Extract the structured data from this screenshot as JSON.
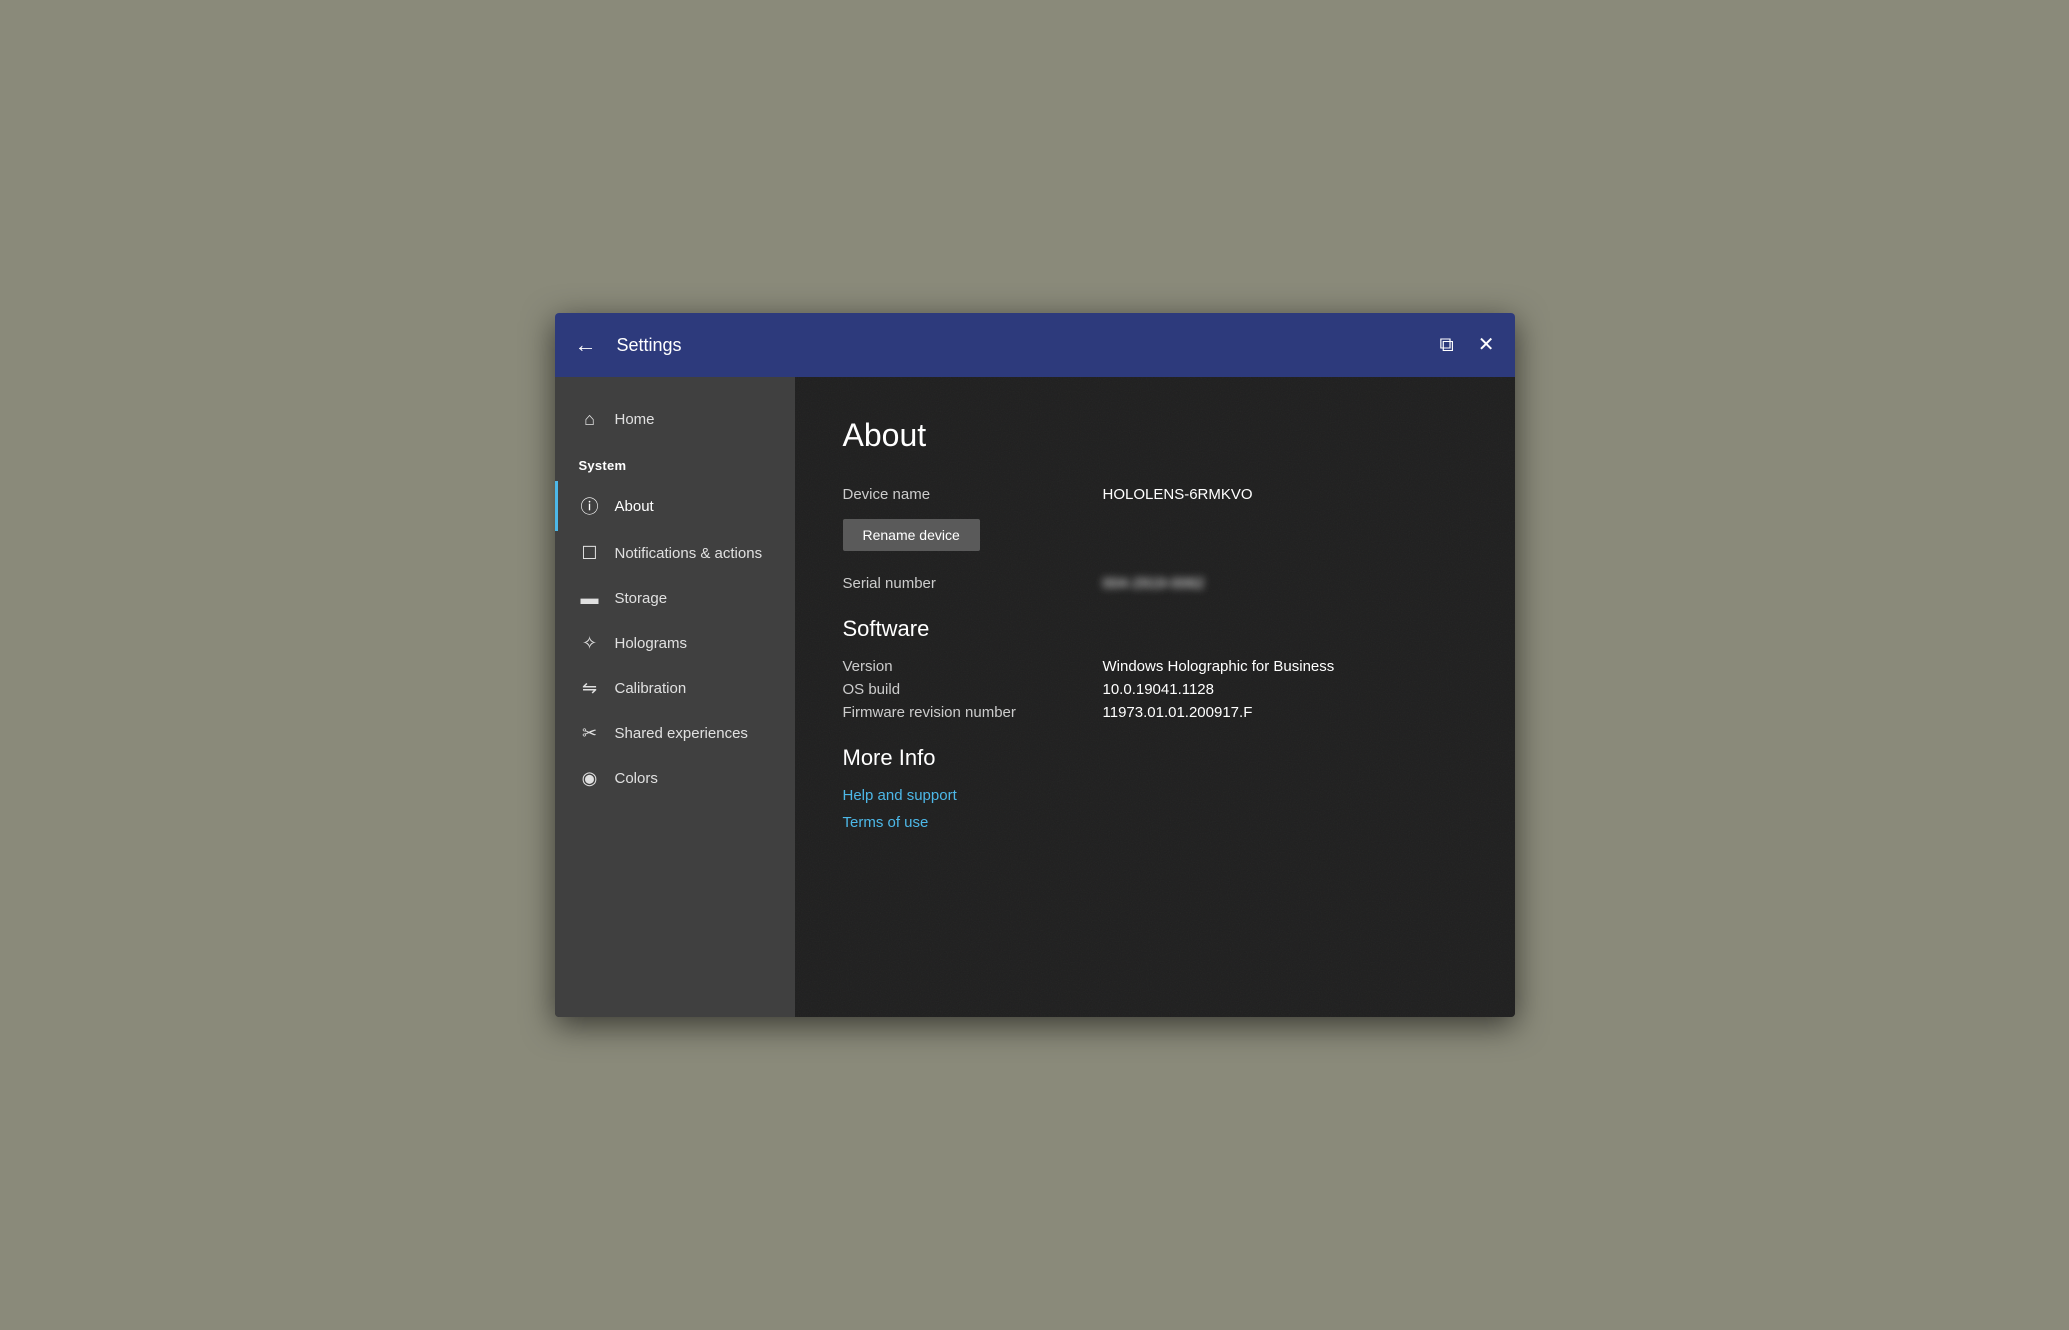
{
  "titlebar": {
    "title": "Settings",
    "back_label": "←",
    "minimize_label": "⧉",
    "close_label": "✕"
  },
  "sidebar": {
    "home_label": "Home",
    "system_label": "System",
    "items": [
      {
        "id": "about",
        "label": "About",
        "icon": "ℹ",
        "active": true
      },
      {
        "id": "notifications",
        "label": "Notifications & actions",
        "icon": "□",
        "active": false
      },
      {
        "id": "storage",
        "label": "Storage",
        "icon": "▭",
        "active": false
      },
      {
        "id": "holograms",
        "label": "Holograms",
        "icon": "✦",
        "active": false
      },
      {
        "id": "calibration",
        "label": "Calibration",
        "icon": "⇌",
        "active": false
      },
      {
        "id": "shared-experiences",
        "label": "Shared experiences",
        "icon": "✂",
        "active": false
      },
      {
        "id": "colors",
        "label": "Colors",
        "icon": "◎",
        "active": false
      }
    ]
  },
  "main": {
    "page_title": "About",
    "device_name_label": "Device name",
    "device_name_value": "HOLOLENS-6RMKVO",
    "rename_btn_label": "Rename device",
    "serial_number_label": "Serial number",
    "serial_number_value": "004-2919-0062",
    "software_heading": "Software",
    "version_label": "Version",
    "version_value": "Windows Holographic for Business",
    "os_build_label": "OS build",
    "os_build_value": "10.0.19041.1128",
    "firmware_label": "Firmware revision number",
    "firmware_value": "11973.01.01.200917.F",
    "more_info_heading": "More Info",
    "help_link": "Help and support",
    "terms_link": "Terms of use"
  }
}
